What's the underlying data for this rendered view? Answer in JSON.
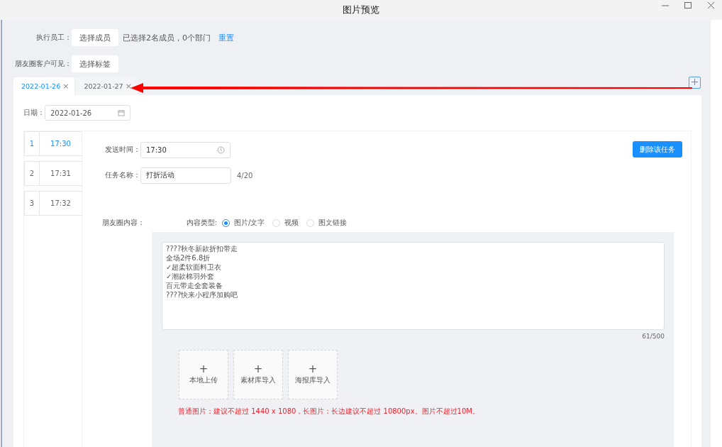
{
  "window": {
    "title": "图片预览"
  },
  "executor": {
    "label": "执行员工：",
    "button": "选择成员",
    "summary": "已选择2名成员，0个部门",
    "reset": "重置"
  },
  "visibility": {
    "label": "朋友圈客户可见：",
    "button": "选择标签"
  },
  "tabs": [
    {
      "label": "2022-01-26",
      "close": "×",
      "selected": true
    },
    {
      "label": "2022-01-27",
      "close": "×",
      "selected": false
    }
  ],
  "date": {
    "label": "日期：",
    "value": "2022-01-26"
  },
  "tasks": [
    {
      "index": "1",
      "time": "17:30",
      "selected": true
    },
    {
      "index": "2",
      "time": "17:31",
      "selected": false
    },
    {
      "index": "3",
      "time": "17:32",
      "selected": false
    }
  ],
  "form": {
    "send_time": {
      "label": "发送时间：",
      "value": "17:30"
    },
    "task_name": {
      "label": "任务名称：",
      "value": "打折活动",
      "counter": "4/20"
    },
    "delete_button": "删除该任务",
    "content_label": "朋友圈内容：",
    "content_type": {
      "label": "内容类型:",
      "options": [
        {
          "label": "图片/文字",
          "selected": true
        },
        {
          "label": "视频",
          "selected": false
        },
        {
          "label": "图文链接",
          "selected": false
        }
      ]
    },
    "text_lines": [
      "????秋冬新款折扣带走",
      "全场2件6.8折",
      "✓超柔软面料卫衣",
      "✓潮款棉羽外套",
      "百元带走全套装备",
      "????快来小程序加购吧"
    ],
    "text_counter": "61/500",
    "uploads": [
      {
        "plus": "+",
        "label": "本地上传"
      },
      {
        "plus": "+",
        "label": "素材库导入"
      },
      {
        "plus": "+",
        "label": "海报库导入"
      }
    ],
    "tip": "普通图片：建议不超过 1440 x 1080，长图片：长边建议不超过 10800px。图片不超过10M。"
  }
}
